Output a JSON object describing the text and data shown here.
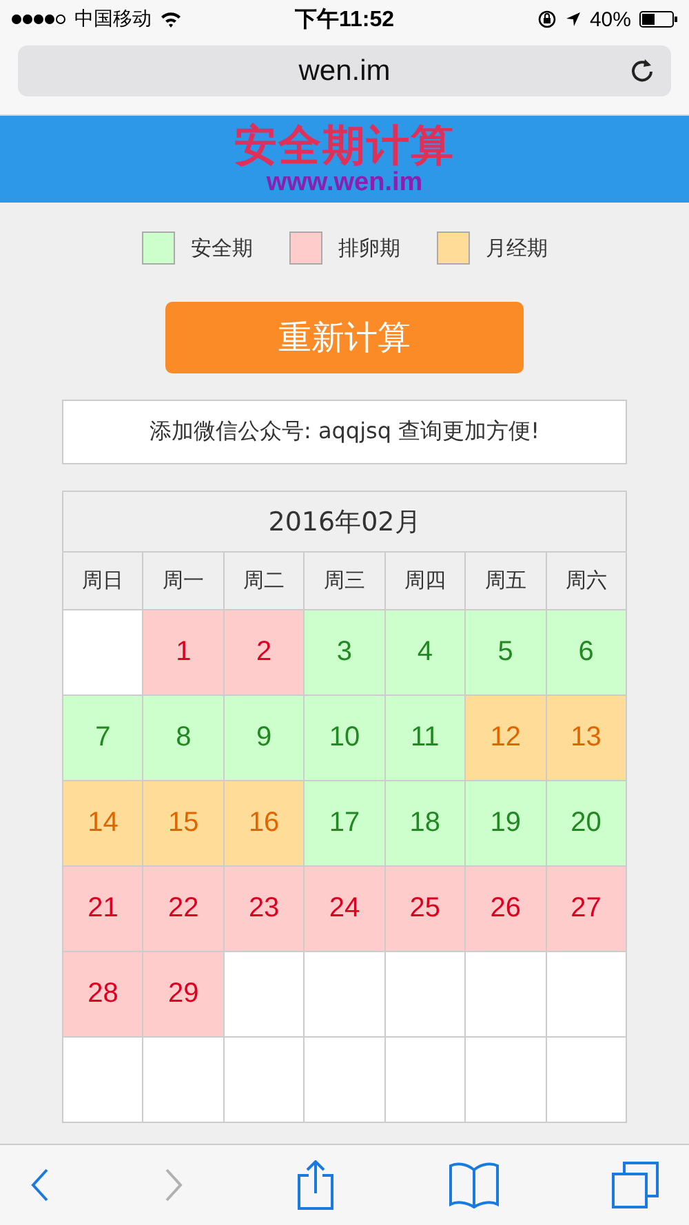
{
  "status_bar": {
    "carrier": "中国移动",
    "time": "下午11:52",
    "battery": "40%"
  },
  "address_bar": {
    "url": "wen.im"
  },
  "header": {
    "title": "安全期计算",
    "subtitle": "www.wen.im"
  },
  "legend": [
    {
      "kind": "safe",
      "label": "安全期"
    },
    {
      "kind": "ovulation",
      "label": "排卵期"
    },
    {
      "kind": "menstrual",
      "label": "月经期"
    }
  ],
  "recalculate_button": "重新计算",
  "notice": "添加微信公众号: aqqjsq 查询更加方便!",
  "calendar": {
    "month": "2016年02月",
    "weekdays": [
      "周日",
      "周一",
      "周二",
      "周三",
      "周四",
      "周五",
      "周六"
    ],
    "weeks": [
      [
        {
          "kind": "empty"
        },
        {
          "kind": "ovulation",
          "day": "1"
        },
        {
          "kind": "ovulation",
          "day": "2"
        },
        {
          "kind": "safe",
          "day": "3"
        },
        {
          "kind": "safe",
          "day": "4"
        },
        {
          "kind": "safe",
          "day": "5"
        },
        {
          "kind": "safe",
          "day": "6"
        }
      ],
      [
        {
          "kind": "safe",
          "day": "7"
        },
        {
          "kind": "safe",
          "day": "8"
        },
        {
          "kind": "safe",
          "day": "9"
        },
        {
          "kind": "safe",
          "day": "10"
        },
        {
          "kind": "safe",
          "day": "11"
        },
        {
          "kind": "menstrual",
          "day": "12"
        },
        {
          "kind": "menstrual",
          "day": "13"
        }
      ],
      [
        {
          "kind": "menstrual",
          "day": "14"
        },
        {
          "kind": "menstrual",
          "day": "15"
        },
        {
          "kind": "menstrual",
          "day": "16"
        },
        {
          "kind": "safe",
          "day": "17"
        },
        {
          "kind": "safe",
          "day": "18"
        },
        {
          "kind": "safe",
          "day": "19"
        },
        {
          "kind": "safe",
          "day": "20"
        }
      ],
      [
        {
          "kind": "ovulation",
          "day": "21"
        },
        {
          "kind": "ovulation",
          "day": "22"
        },
        {
          "kind": "ovulation",
          "day": "23"
        },
        {
          "kind": "ovulation",
          "day": "24"
        },
        {
          "kind": "ovulation",
          "day": "25"
        },
        {
          "kind": "ovulation",
          "day": "26"
        },
        {
          "kind": "ovulation",
          "day": "27"
        }
      ],
      [
        {
          "kind": "ovulation",
          "day": "28"
        },
        {
          "kind": "ovulation",
          "day": "29"
        },
        {
          "kind": "empty"
        },
        {
          "kind": "empty"
        },
        {
          "kind": "empty"
        },
        {
          "kind": "empty"
        },
        {
          "kind": "empty"
        }
      ],
      [
        {
          "kind": "empty"
        },
        {
          "kind": "empty"
        },
        {
          "kind": "empty"
        },
        {
          "kind": "empty"
        },
        {
          "kind": "empty"
        },
        {
          "kind": "empty"
        },
        {
          "kind": "empty"
        }
      ]
    ]
  },
  "toolbar": {
    "forward_disabled": true
  }
}
